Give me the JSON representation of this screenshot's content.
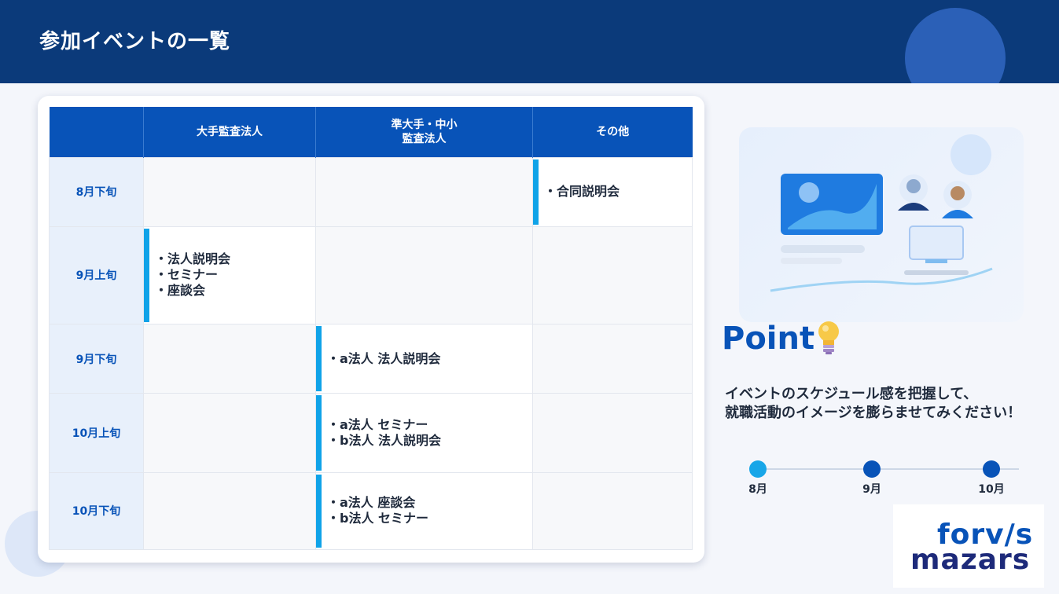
{
  "page": {
    "title": "参加イベントの一覧"
  },
  "table": {
    "headers": [
      "",
      "大手監査法人",
      "準大手・中小\n監査法人",
      "その他"
    ],
    "header_lines": {
      "col1": "大手監査法人",
      "col2_line1": "準大手・中小",
      "col2_line2": "監査法人",
      "col3": "その他"
    },
    "rows": [
      {
        "month": "8月下旬",
        "big": [],
        "mid": [],
        "other": [
          "・合同説明会"
        ]
      },
      {
        "month": "9月上旬",
        "big": [
          "・法人説明会",
          "・セミナー",
          "・座談会"
        ],
        "mid": [],
        "other": []
      },
      {
        "month": "9月下旬",
        "big": [],
        "mid": [
          "・a法人 法人説明会"
        ],
        "other": []
      },
      {
        "month": "10月上旬",
        "big": [],
        "mid": [
          "・a法人 セミナー",
          "・b法人 法人説明会"
        ],
        "other": []
      },
      {
        "month": "10月下旬",
        "big": [],
        "mid": [
          "・a法人 座談会",
          "・b法人 セミナー"
        ],
        "other": []
      }
    ]
  },
  "point": {
    "title": "Point",
    "lines": [
      "イベントのスケジュール感を把握して、",
      "就職活動のイメージを膨らませてみください！"
    ]
  },
  "timeline": {
    "labels": [
      "8月",
      "9月",
      "10月"
    ],
    "colors": [
      "#18a6e8",
      "#0853b8",
      "#0853b8"
    ]
  },
  "logo": {
    "line1": "forv/s",
    "line2": "mazars"
  },
  "colors": {
    "header_bg": "#0b3a7a",
    "table_header": "#0853b8",
    "accent_bar": "#10a3e8",
    "month_text": "#0853b8"
  },
  "icons": [
    "lightbulb-icon",
    "presentation-illustration"
  ]
}
